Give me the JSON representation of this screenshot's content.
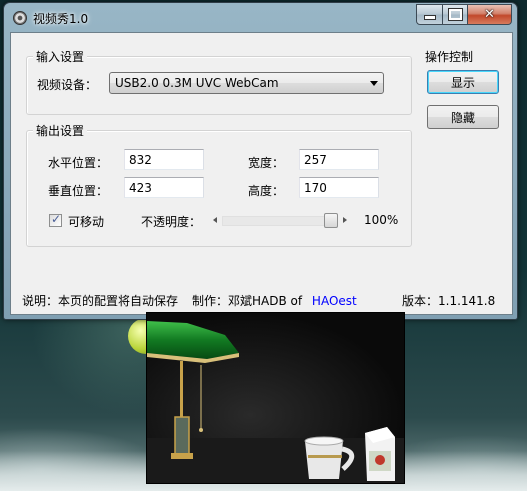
{
  "window": {
    "title": "视频秀1.0",
    "close_glyph": "✕"
  },
  "input_group": {
    "title": "输入设置",
    "device_label": "视频设备：",
    "device_value": "USB2.0 0.3M UVC WebCam"
  },
  "control_group": {
    "title": "操作控制",
    "show_label": "显示",
    "hide_label": "隐藏"
  },
  "output_group": {
    "title": "输出设置",
    "hpos_label": "水平位置：",
    "hpos_value": "832",
    "vpos_label": "垂直位置：",
    "vpos_value": "423",
    "width_label": "宽度：",
    "width_value": "257",
    "height_label": "高度：",
    "height_value": "170",
    "movable_label": "可移动",
    "movable_checked": true,
    "opacity_label": "不透明度：",
    "opacity_value": "100%",
    "opacity_fraction": 1.0
  },
  "footer": {
    "note": "说明：本页的配置将自动保存",
    "author_prefix": "制作：邓斌HADB of",
    "author_link": "HAOest",
    "version": "版本：1.1.141.8"
  },
  "icons": [
    "app-icon",
    "minimize-icon",
    "maximize-icon",
    "close-icon",
    "dropdown-arrow-icon",
    "check-icon",
    "slider-left-arrow-icon",
    "slider-right-arrow-icon"
  ],
  "colors": {
    "link": "#0000ff",
    "title_bar": "#98b6c6",
    "dialog_bg": "#f0f0f0",
    "close_button": "#c2482b"
  }
}
